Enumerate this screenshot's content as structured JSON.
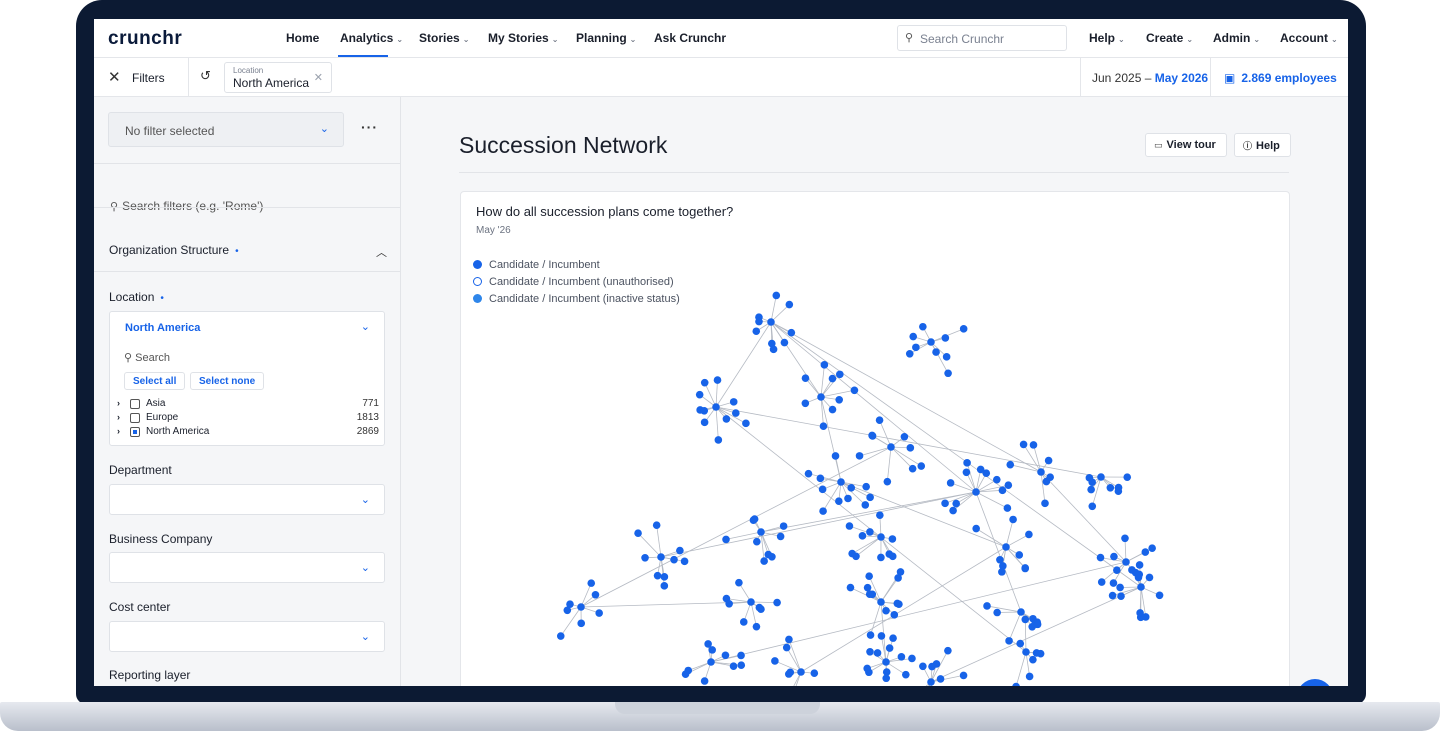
{
  "app": {
    "logo": "crunchr"
  },
  "nav": {
    "items": [
      {
        "label": "Home",
        "chevron": ""
      },
      {
        "label": "Analytics",
        "chevron": "⌄"
      },
      {
        "label": "Stories",
        "chevron": "⌄"
      },
      {
        "label": "My Stories",
        "chevron": "⌄"
      },
      {
        "label": "Planning",
        "chevron": "⌄"
      },
      {
        "label": "Ask Crunchr",
        "chevron": ""
      }
    ],
    "active_index": 1,
    "search_placeholder": "Search Crunchr",
    "right_items": [
      {
        "label": "Help",
        "chevron": "⌄"
      },
      {
        "label": "Create",
        "chevron": "⌄"
      },
      {
        "label": "Admin",
        "chevron": "⌄"
      },
      {
        "label": "Account",
        "chevron": "⌄"
      }
    ]
  },
  "filterbar": {
    "title": "Filters",
    "chip_label": "Location",
    "chip_value": "North America",
    "date_from": "Jun 2025 –",
    "date_to": "May 2026",
    "employees": "2.869 employees"
  },
  "sidebar": {
    "no_filter": "No filter selected",
    "search_placeholder": "Search filters (e.g. 'Rome')",
    "org_structure": "Organization Structure",
    "location": {
      "label": "Location",
      "selected": "North America",
      "search": "Search",
      "select_all": "Select all",
      "select_none": "Select none",
      "options": [
        {
          "name": "Asia",
          "count": "771",
          "checked": false
        },
        {
          "name": "Europe",
          "count": "1813",
          "checked": false
        },
        {
          "name": "North America",
          "count": "2869",
          "checked": true
        }
      ]
    },
    "fields": [
      "Department",
      "Business Company",
      "Cost center",
      "Reporting layer"
    ]
  },
  "main": {
    "title": "Succession Network",
    "view_tour": "View tour",
    "help": "Help",
    "card_title": "How do all succession plans come together?",
    "card_subtitle": "May '26",
    "legend": [
      {
        "label": "Candidate / Incumbent",
        "style": "filled",
        "color": "#1763e8"
      },
      {
        "label": "Candidate / Incumbent (unauthorised)",
        "style": "hollow",
        "color": "#1763e8"
      },
      {
        "label": "Candidate / Incumbent (inactive status)",
        "style": "filled",
        "color": "#2e86ea"
      }
    ]
  },
  "colors": {
    "accent": "#1763e8",
    "frame": "#0c1a33"
  }
}
